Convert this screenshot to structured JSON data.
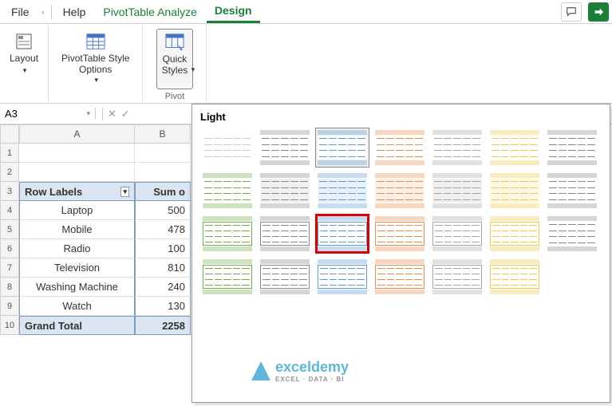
{
  "tabs": {
    "file": "File",
    "help": "Help",
    "analyze": "PivotTable Analyze",
    "design": "Design"
  },
  "ribbon": {
    "layout": "Layout",
    "pivot_style_options": "PivotTable Style\nOptions",
    "quick_styles": "Quick\nStyles",
    "group_name": "Pivot"
  },
  "namebox": "A3",
  "columns": {
    "a": "A",
    "b": "B"
  },
  "rows": [
    "1",
    "2",
    "3",
    "4",
    "5",
    "6",
    "7",
    "8",
    "9",
    "10"
  ],
  "pivot": {
    "header_a": "Row Labels",
    "header_b": "Sum o",
    "data": [
      {
        "label": "Laptop",
        "value": "500"
      },
      {
        "label": "Mobile",
        "value": "478"
      },
      {
        "label": "Radio",
        "value": "100"
      },
      {
        "label": "Television",
        "value": "810"
      },
      {
        "label": "Washing Machine",
        "value": "240"
      },
      {
        "label": "Watch",
        "value": "130"
      }
    ],
    "grand_label": "Grand Total",
    "grand_value": "2258"
  },
  "gallery": {
    "title": "Light",
    "styles": [
      {
        "accent": "none"
      },
      {
        "accent": "#888"
      },
      {
        "accent": "#5b9bd5",
        "selected": true
      },
      {
        "accent": "#e88b4a"
      },
      {
        "accent": "#a5a5a5"
      },
      {
        "accent": "#f4c842"
      },
      {
        "accent": "#888"
      },
      {
        "accent": "#70ad47"
      },
      {
        "accent": "#888",
        "fill": "#f0f0f0"
      },
      {
        "accent": "#5b9bd5",
        "fill": "#e8f0fa"
      },
      {
        "accent": "#e88b4a",
        "fill": "#fbefe6"
      },
      {
        "accent": "#a5a5a5",
        "fill": "#f0f0f0"
      },
      {
        "accent": "#f4c842",
        "fill": "#fdf7e3"
      },
      {
        "accent": "#888"
      },
      {
        "accent": "#70ad47",
        "border": true
      },
      {
        "accent": "#888",
        "border": true
      },
      {
        "accent": "#5b9bd5",
        "border": true,
        "red": true
      },
      {
        "accent": "#e88b4a",
        "border": true
      },
      {
        "accent": "#a5a5a5",
        "border": true
      },
      {
        "accent": "#f4c842",
        "border": true
      },
      {
        "accent": "#888"
      },
      {
        "accent": "#70ad47",
        "grid": true
      },
      {
        "accent": "#888",
        "grid": true
      },
      {
        "accent": "#5b9bd5",
        "grid": true
      },
      {
        "accent": "#e88b4a",
        "grid": true
      },
      {
        "accent": "#a5a5a5",
        "grid": true
      },
      {
        "accent": "#f4c842",
        "grid": true
      }
    ]
  },
  "watermark": {
    "text": "exceldemy",
    "sub": "EXCEL · DATA · BI"
  }
}
